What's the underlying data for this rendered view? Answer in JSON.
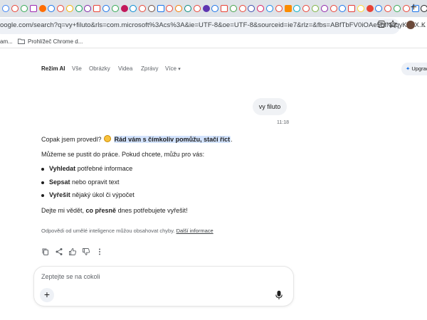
{
  "browser": {
    "tab_favicon_colors": [
      "#4285f4",
      "#e94235",
      "#34a853",
      "#9c27b0",
      "#ff6d00",
      "#1a73e8",
      "#e94235",
      "#f4b400",
      "#0f9d58",
      "#7b1fa2",
      "#e94235",
      "#1a73e8",
      "#34a853",
      "#c2185b",
      "#0288d1",
      "#e94235",
      "#6d4c41",
      "#1a73e8",
      "#e94235",
      "#f57c00",
      "#00897b",
      "#e94235",
      "#5e35b1",
      "#1a73e8",
      "#e94235",
      "#43a047",
      "#e94235",
      "#3949ab",
      "#d81b60",
      "#1e88e5",
      "#e94235",
      "#fb8c00",
      "#00acc1",
      "#e94235",
      "#7cb342",
      "#8e24aa",
      "#e94235",
      "#1a73e8",
      "#e53935",
      "#fdd835",
      "#e94235",
      "#1a73e8",
      "#e94235",
      "#34a853",
      "#e94235",
      "#1a73e8",
      "#212121",
      "#e94235",
      "#1a73e8",
      "#e94235",
      "#7b1fa2",
      "#e94235",
      "#1a73e8",
      "#9c27b0",
      "#c2185b",
      "#e94235"
    ],
    "new_tab_label": "+",
    "url": "oogle.com/search?q=vy+filuto&rls=com.microsoft%3Acs%3A&ie=UTF-8&oe=UTF-8&sourceid=ie7&rlz=&fbs=ABfTbFV0iOAe5bfNeqyKguX...",
    "profile_initial": "K",
    "bookmarks": [
      {
        "label": "am...",
        "icon": "folder-icon"
      },
      {
        "label": "Prohlížeč Chrome d...",
        "icon": "folder-icon"
      }
    ]
  },
  "search_tabs": [
    "Režim AI",
    "Vše",
    "Obrázky",
    "Videa",
    "Zprávy",
    "Více"
  ],
  "more_caret": "▾",
  "upgrade_label": "Upgrad",
  "conversation": {
    "user_message": "vy filuto",
    "user_time": "11:18",
    "answer": {
      "line1_prefix": "Copak jsem provedl?",
      "line1_highlight": "Rád vám s čímkoliv pomůžu, stačí říct",
      "line1_suffix": ".",
      "line2": "Můžeme se pustit do práce. Pokud chcete, můžu pro vás:",
      "bullets": [
        {
          "bold": "Vyhledat",
          "rest": " potřebné informace"
        },
        {
          "bold": "Sepsat",
          "rest": " nebo opravit text"
        },
        {
          "bold": "Vyřešit",
          "rest": " nějaký úkol či výpočet"
        }
      ],
      "closing_prefix": "Dejte mi vědět, ",
      "closing_bold": "co přesně",
      "closing_suffix": " dnes potřebujete vyřešit!"
    },
    "disclaimer_text": "Odpovědi od umělé inteligence můžou obsahovat chyby.",
    "disclaimer_link": "Další informace"
  },
  "composer": {
    "placeholder": "Zeptejte se na cokoli",
    "plus_label": "+"
  }
}
